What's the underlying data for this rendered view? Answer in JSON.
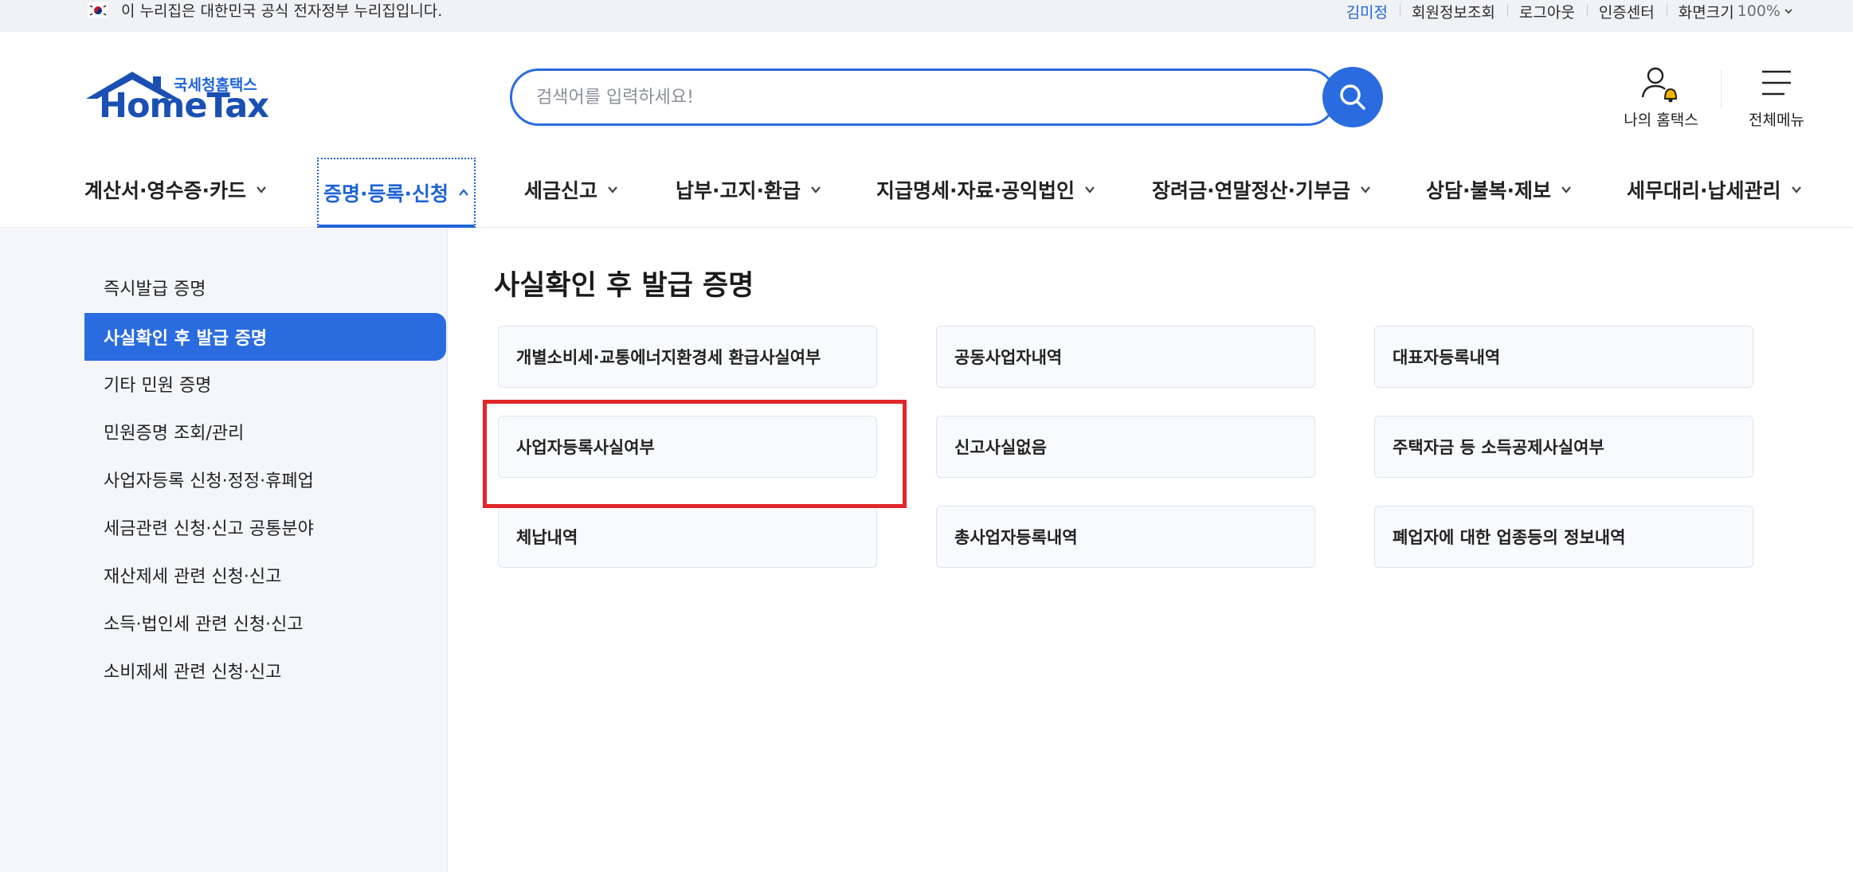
{
  "topbar": {
    "gov_notice": "이 누리집은 대한민국 공식 전자정부 누리집입니다.",
    "user_name": "김미정",
    "links": [
      "회원정보조회",
      "로그아웃",
      "인증센터"
    ],
    "zoom_label": "화면크기",
    "zoom_value": "100%"
  },
  "header": {
    "logo_sub": "국세청홈택스",
    "logo_main": "HomeTax",
    "search_placeholder": "검색어를 입력하세요!",
    "my_hometax": "나의 홈택스",
    "all_menu": "전체메뉴"
  },
  "gnb": [
    "계산서·영수증·카드",
    "증명·등록·신청",
    "세금신고",
    "납부·고지·환급",
    "지급명세·자료·공익법인",
    "장려금·연말정산·기부금",
    "상담·불복·제보",
    "세무대리·납세관리"
  ],
  "sidebar": [
    "즉시발급 증명",
    "사실확인 후 발급 증명",
    "기타 민원 증명",
    "민원증명 조회/관리",
    "사업자등록 신청·정정·휴폐업",
    "세금관련 신청·신고 공통분야",
    "재산제세 관련 신청·신고",
    "소득·법인세 관련 신청·신고",
    "소비제세 관련 신청·신고"
  ],
  "main": {
    "title": "사실확인 후 발급 증명",
    "cards": [
      "개별소비세·교통에너지환경세 환급사실여부",
      "공동사업자내역",
      "대표자등록내역",
      "사업자등록사실여부",
      "신고사실없음",
      "주택자금 등 소득공제사실여부",
      "체납내역",
      "총사업자등록내역",
      "폐업자에 대한 업종등의 정보내역"
    ]
  },
  "colors": {
    "accent": "#2a6ce0",
    "highlight": "#e0262a"
  }
}
